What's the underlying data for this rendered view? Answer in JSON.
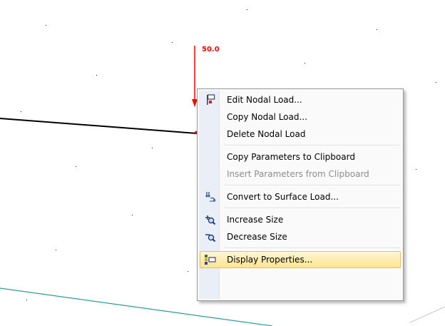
{
  "load": {
    "value_label": "50.0",
    "color": "#ff0000"
  },
  "colors": {
    "member_line": "#000000",
    "surface_edge": "#2a9d9d",
    "menu_highlight": "#fde48f"
  },
  "context_menu": {
    "items": [
      {
        "label": "Edit Nodal Load...",
        "icon": "edit-nodal-load-icon",
        "enabled": true
      },
      {
        "label": "Copy Nodal Load...",
        "icon": "",
        "enabled": true
      },
      {
        "label": "Delete Nodal Load",
        "icon": "",
        "enabled": true
      },
      {
        "label": "Copy Parameters to Clipboard",
        "icon": "",
        "enabled": true
      },
      {
        "label": "Insert Parameters from Clipboard",
        "icon": "",
        "enabled": false
      },
      {
        "label": "Convert to Surface Load...",
        "icon": "convert-surface-load-icon",
        "enabled": true
      },
      {
        "label": "Increase Size",
        "icon": "zoom-increase-icon",
        "enabled": true
      },
      {
        "label": "Decrease Size",
        "icon": "zoom-decrease-icon",
        "enabled": true
      },
      {
        "label": "Display Properties...",
        "icon": "display-properties-icon",
        "enabled": true,
        "highlighted": true
      }
    ]
  }
}
